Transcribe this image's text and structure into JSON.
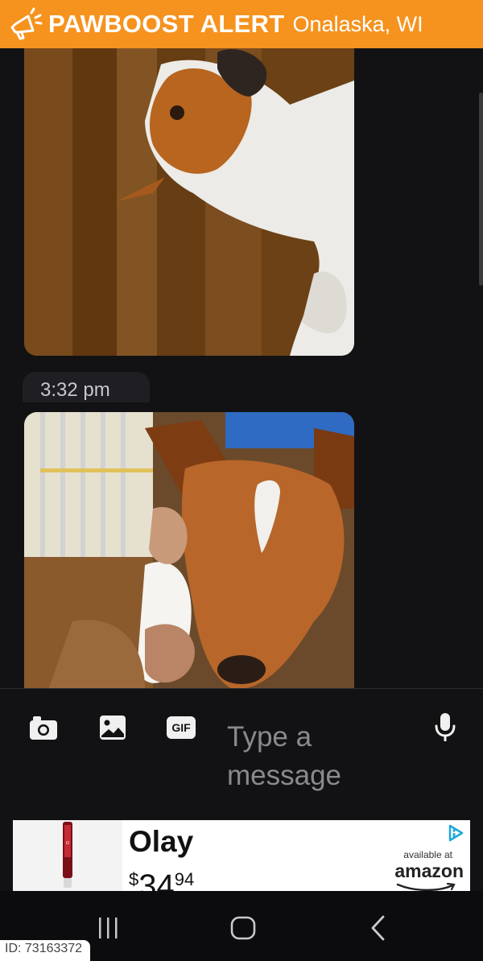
{
  "banner": {
    "brand": "PAWBOOST ALERT",
    "city": "Onalaska, WI",
    "icon": "megaphone-icon",
    "color": "#f6921e"
  },
  "chat": {
    "timestamp": "3:32 pm",
    "photos": [
      {
        "subject": "dog-lying-on-wood-floor"
      },
      {
        "subject": "dog-being-petted"
      }
    ]
  },
  "composer": {
    "placeholder": "Type a message",
    "gif_label": "GIF",
    "icons": [
      "camera-icon",
      "gallery-icon",
      "gif-icon",
      "microphone-icon"
    ]
  },
  "ad": {
    "title": "Olay",
    "price_currency": "$",
    "price_int": "34",
    "price_dec": "94",
    "available": "available at",
    "store": "amazon"
  },
  "navbar": {
    "icons": [
      "recents-icon",
      "home-icon",
      "back-icon"
    ]
  },
  "id_label": "ID: 73163372"
}
